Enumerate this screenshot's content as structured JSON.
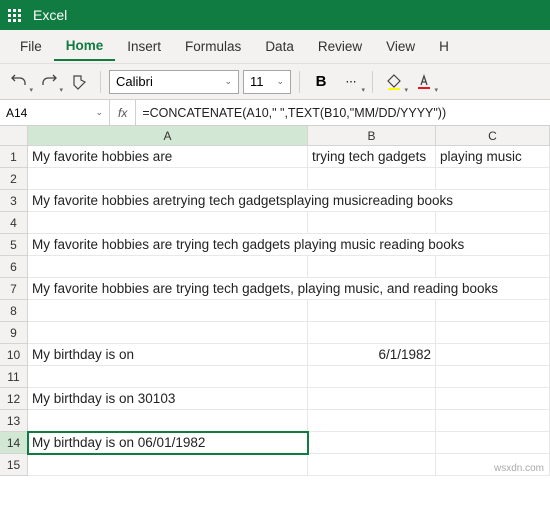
{
  "app": {
    "name": "Excel"
  },
  "menu": {
    "file": "File",
    "home": "Home",
    "insert": "Insert",
    "formulas": "Formulas",
    "data": "Data",
    "review": "Review",
    "view": "View",
    "help": "H"
  },
  "toolbar": {
    "font_name": "Calibri",
    "font_size": "11"
  },
  "formula_bar": {
    "name_box": "A14",
    "fx": "fx",
    "formula": "=CONCATENATE(A10,\" \",TEXT(B10,\"MM/DD/YYYY\"))"
  },
  "columns": {
    "A": "A",
    "B": "B",
    "C": "C"
  },
  "cells": {
    "r1": {
      "A": "My favorite hobbies are",
      "B": "trying tech gadgets",
      "C": "playing music"
    },
    "r3": {
      "A": "My favorite hobbies aretrying tech gadgetsplaying musicreading books"
    },
    "r5": {
      "A": "My favorite hobbies are trying tech gadgets playing music reading books"
    },
    "r7": {
      "A": "My favorite hobbies are trying tech gadgets, playing music, and reading books"
    },
    "r10": {
      "A": "My birthday is on",
      "B": "6/1/1982"
    },
    "r12": {
      "A": "My birthday is on 30103"
    },
    "r14": {
      "A": "My birthday is on 06/01/1982"
    }
  },
  "watermark": "wsxdn.com"
}
